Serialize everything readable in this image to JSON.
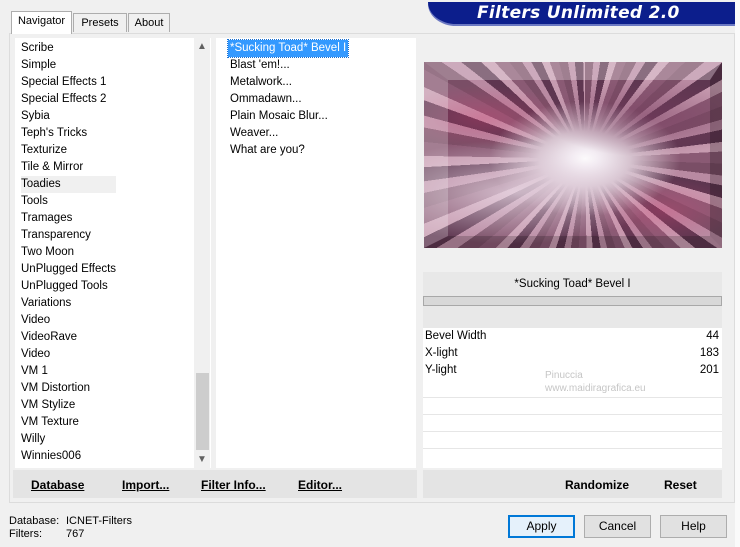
{
  "tabs": [
    {
      "label": "Navigator",
      "active": true
    },
    {
      "label": "Presets",
      "active": false
    },
    {
      "label": "About",
      "active": false
    }
  ],
  "banner_title": "Filters Unlimited 2.0",
  "categories": [
    "Scribe",
    "Simple",
    "Special Effects 1",
    "Special Effects 2",
    "Sybia",
    "Teph's Tricks",
    "Texturize",
    "Tile & Mirror",
    "Toadies",
    "Tools",
    "Tramages",
    "Transparency",
    "Two Moon",
    "UnPlugged Effects",
    "UnPlugged Tools",
    "Variations",
    "Video",
    "VideoRave",
    "Video",
    "VM 1",
    "VM Distortion",
    "VM Stylize",
    "VM Texture",
    "Willy",
    "Winnies006"
  ],
  "selected_category": "Toadies",
  "filters": [
    "*Sucking Toad*  Bevel I",
    "Blast 'em!...",
    "Metalwork...",
    "Ommadawn...",
    "Plain Mosaic Blur...",
    "Weaver...",
    "What are you?"
  ],
  "selected_filter": "*Sucking Toad*  Bevel I",
  "filter_title": "*Sucking Toad*  Bevel I",
  "params": [
    {
      "label": "Bevel Width",
      "value": "44"
    },
    {
      "label": "X-light",
      "value": "183"
    },
    {
      "label": "Y-light",
      "value": "201"
    }
  ],
  "watermark": {
    "name": "Pinuccia",
    "site": "www.maidiragrafica.eu"
  },
  "toolbar_left": {
    "database": "Database",
    "import": "Import...",
    "filter_info": "Filter Info...",
    "editor": "Editor..."
  },
  "toolbar_right": {
    "randomize": "Randomize",
    "reset": "Reset"
  },
  "footer": {
    "database_label": "Database:",
    "database_value": "ICNET-Filters",
    "filters_label": "Filters:",
    "filters_value": "767"
  },
  "buttons": {
    "apply": "Apply",
    "cancel": "Cancel",
    "help": "Help"
  },
  "colors": {
    "banner": "#0c1e8c",
    "selection": "#3399ff",
    "default_button_border": "#0078d7"
  }
}
